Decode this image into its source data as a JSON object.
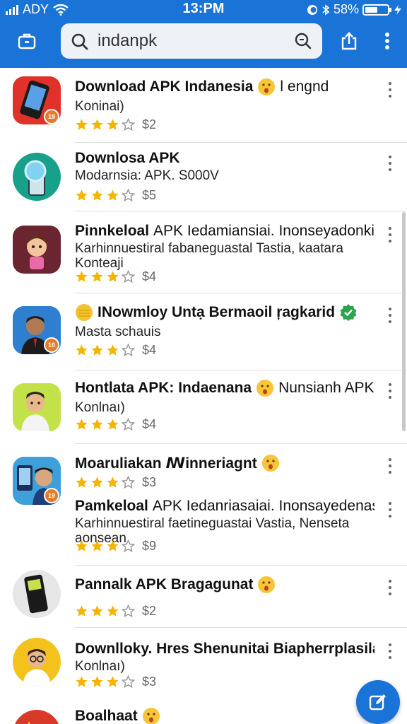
{
  "status_bar": {
    "carrier": "ADY",
    "time": "13:PM",
    "battery": "58%",
    "battery_level": 0.58
  },
  "search": {
    "value": "indanpk"
  },
  "apps": [
    {
      "title": "Download APK Indanesia",
      "title_suffix": "l engnd",
      "has_emoji": true,
      "has_verified": false,
      "subtitle": "Koninai)",
      "rating": 3,
      "price": "$2",
      "badge": "19",
      "icon": "phone-icon"
    },
    {
      "title": "Downlosa APK",
      "title_suffix": "",
      "has_emoji": false,
      "has_verified": false,
      "subtitle": "Modarnsia: APK. S000V",
      "rating": 3,
      "price": "$5",
      "badge": "",
      "icon": "magnifier-phone-icon"
    },
    {
      "title": "Pinnkeloal",
      "title_suffix": "APK Iedamiansiai. Inonseyadonkie",
      "has_emoji": false,
      "has_verified": false,
      "subtitle": "Karhinnuestiral fabaneguastal Tastia, kaatara Konteaji",
      "rating": 3,
      "price": "$4",
      "badge": "",
      "icon": "cartoon-girl-icon"
    },
    {
      "title": "INowmloy Untạ Bermaoil ŗagkarid",
      "title_suffix": "",
      "has_emoji": false,
      "has_coin": true,
      "has_verified": true,
      "subtitle": "Masta schauis",
      "rating": 3,
      "price": "$4",
      "badge": "10",
      "icon": "man-portrait-icon"
    },
    {
      "title": "Hontlata APK: Indaenana",
      "title_suffix": "Nunsianh APK",
      "has_emoji": true,
      "has_verified": false,
      "subtitle": "Konlnaı)",
      "rating": 3,
      "price": "$4",
      "badge": "",
      "icon": "cartoon-man-icon"
    },
    {
      "title": "Moaruliakan ꟿinneriagnt",
      "title_suffix": "",
      "has_emoji": true,
      "has_verified": false,
      "subtitle": "",
      "rating": 3,
      "price": "$3",
      "badge": "19",
      "icon": "man-with-phone-icon"
    },
    {
      "title": "Pamkeloal",
      "title_suffix": "APK Iedanriasaiai. Inonsayedenase",
      "has_emoji": false,
      "has_verified": false,
      "subtitle": "Karhinnuestiral faetineguastai Vastia, Nenseta aonsean",
      "rating": 3,
      "price": "$9",
      "badge": "",
      "icon": ""
    },
    {
      "title": "Pannalk APK Bragagunat",
      "title_suffix": "",
      "has_emoji": true,
      "has_verified": false,
      "subtitle": "",
      "rating": 3,
      "price": "$2",
      "badge": "",
      "icon": "feature-phone-icon"
    },
    {
      "title": "Downlloky. Hres Shenunitai Biapherrplasila",
      "title_suffix": "",
      "has_emoji": false,
      "has_verified": false,
      "subtitle": "Konlnaı)",
      "rating": 3,
      "price": "$3",
      "badge": "",
      "icon": "cartoon-glasses-man-icon"
    },
    {
      "title": "Boalhaat",
      "title_suffix": "",
      "has_emoji": true,
      "has_verified": false,
      "subtitle": "",
      "rating": 0,
      "price": "",
      "badge": "",
      "icon": "star-flag-icon"
    }
  ],
  "colors": {
    "brand": "#1a73d6",
    "star": "#f4b400",
    "badge": "#e37b2a",
    "verified": "#2ea44f"
  }
}
